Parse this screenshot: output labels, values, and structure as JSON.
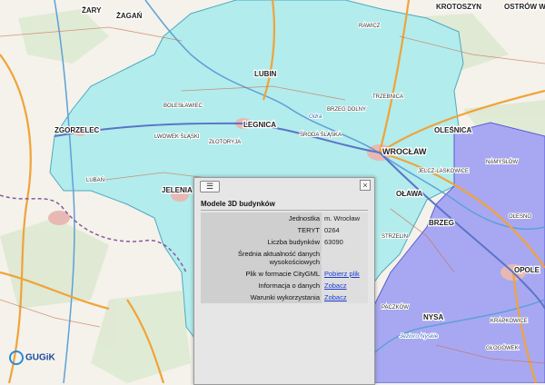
{
  "map": {
    "cities": [
      "ŻARY",
      "ŻAGAŃ",
      "LUBIN",
      "LEGNICA",
      "ZGORZELEC",
      "WROCŁAW",
      "JELENIA GÓRA",
      "OŁAWA",
      "OLEŚNICA",
      "BRZEG",
      "OPOLE",
      "NYSA",
      "KROTOSZYN",
      "OSTRÓW WIELKOPOLSKI"
    ],
    "towns": [
      "RAWICZ",
      "LWÓWEK ŚLĄSKI",
      "BOLESŁAWIEC",
      "ZŁOTORYJA",
      "ŚRODA ŚLĄSKA",
      "TRZEBNICA",
      "NAMYSŁÓW",
      "BRZEG DOLNY",
      "STRZELIN",
      "JELCZ-LASKOWICE",
      "GŁOGÓWEK",
      "KRAPKOWICE",
      "PACZKÓW",
      "LUBAŃ",
      "OLESNO"
    ],
    "rivers": [
      "Odra",
      "Jezioro Nyskie"
    ],
    "colors": {
      "wroclaw_area": "#b2ecec",
      "opole_area": "#a8a8f2",
      "background": "#f4f2ea"
    }
  },
  "popup": {
    "list_icon": "list-icon",
    "close_glyph": "×",
    "title": "Modele 3D budynków",
    "rows": [
      {
        "label": "Jednostka",
        "value": "m. Wrocław"
      },
      {
        "label": "TERYT",
        "value": "0264"
      },
      {
        "label": "Liczba budynków",
        "value": "63090"
      },
      {
        "label": "Średnia aktualność danych wysokościowych",
        "value": ""
      },
      {
        "label": "Plik w formacie CityGML",
        "value": "Pobierz plik"
      },
      {
        "label": "Informacja o danych",
        "value": "Zobacz"
      },
      {
        "label": "Warunki wykorzystania",
        "value": "Zobacz"
      }
    ]
  },
  "logo": {
    "text": "GUGiK"
  }
}
